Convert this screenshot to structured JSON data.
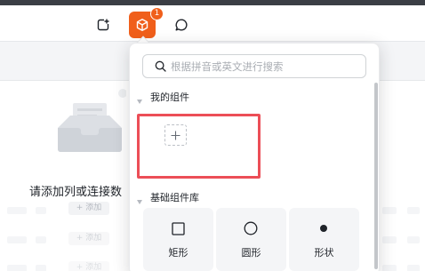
{
  "toolbar": {
    "components_badge": "1",
    "accent_color": "#f05f1b"
  },
  "canvas": {
    "empty_state_text": "请添加列或连接数",
    "add_row_label": "+ 添加"
  },
  "component_panel": {
    "search": {
      "placeholder": "根据拼音或英文进行搜索",
      "value": ""
    },
    "my_components": {
      "title": "我的组件",
      "highlight_color": "#ec4e57"
    },
    "basic_library": {
      "title": "基础组件库",
      "shapes": [
        {
          "label": "矩形",
          "icon": "rectangle-icon"
        },
        {
          "label": "圆形",
          "icon": "circle-icon"
        },
        {
          "label": "形状",
          "icon": "dot-icon"
        }
      ]
    }
  }
}
